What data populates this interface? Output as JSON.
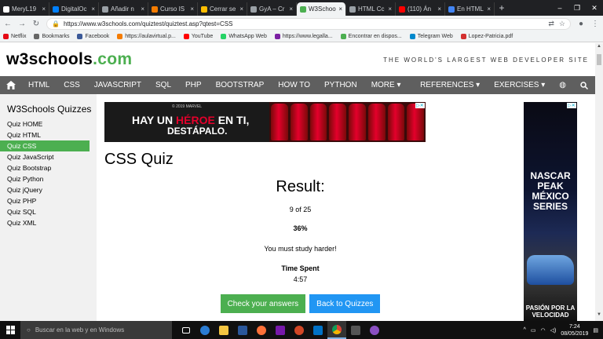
{
  "browser": {
    "tabs": [
      {
        "label": "MeryL19",
        "color": "#ffffff",
        "active": false
      },
      {
        "label": "DigitalOc",
        "color": "#0080ff",
        "active": false
      },
      {
        "label": "Añadir n",
        "color": "#9aa0a6",
        "active": false
      },
      {
        "label": "Curso IS",
        "color": "#f57c00",
        "active": false
      },
      {
        "label": "Cerrar se",
        "color": "#ffbe00",
        "active": false
      },
      {
        "label": "GyA – Cr",
        "color": "#9aa0a6",
        "active": false
      },
      {
        "label": "W3Schoo",
        "color": "#4CAF50",
        "active": true
      },
      {
        "label": "HTML Cc",
        "color": "#9aa0a6",
        "active": false
      },
      {
        "label": "(110) Án",
        "color": "#ff0000",
        "active": false
      },
      {
        "label": "En HTML",
        "color": "#4285f4",
        "active": false
      }
    ],
    "url": "https://www.w3schools.com/quiztest/quiztest.asp?qtest=CSS",
    "bookmarks": [
      "Netflix",
      "Bookmarks",
      "Facebook",
      "https://aulavirtual.p...",
      "YouTube",
      "WhatsApp Web",
      "https://www.legalla...",
      "Encontrar en dispos...",
      "Telegram Web",
      "Lopez-Patricia.pdf"
    ]
  },
  "site": {
    "logo_main": "w3schools",
    "logo_tld": ".com",
    "tagline": "THE WORLD'S LARGEST WEB DEVELOPER SITE",
    "nav": [
      "HTML",
      "CSS",
      "JAVASCRIPT",
      "SQL",
      "PHP",
      "BOOTSTRAP",
      "HOW TO",
      "PYTHON",
      "MORE ▾"
    ],
    "nav_right": [
      "REFERENCES ▾",
      "EXERCISES ▾"
    ]
  },
  "sidebar": {
    "title": "W3Schools Quizzes",
    "items": [
      "Quiz HOME",
      "Quiz HTML",
      "Quiz CSS",
      "Quiz JavaScript",
      "Quiz Bootstrap",
      "Quiz Python",
      "Quiz jQuery",
      "Quiz PHP",
      "Quiz SQL",
      "Quiz XML"
    ],
    "active_index": 2
  },
  "ads": {
    "top_line1a": "HAY UN ",
    "top_line1b": "HÉROE",
    "top_line1c": " EN TI,",
    "top_line2": "DESTÁPALO.",
    "top_small": "© 2019 MARVEL",
    "right_title": "NASCAR PEAK MÉXICO SERIES",
    "right_bottom": "PASIÓN POR LA VELOCIDAD"
  },
  "main": {
    "title": "CSS Quiz",
    "result_heading": "Result:",
    "score": "9 of 25",
    "percent": "36%",
    "message": "You must study harder!",
    "time_label": "Time Spent",
    "time_value": "4:57",
    "btn_check": "Check your answers",
    "btn_back": "Back to Quizzes"
  },
  "taskbar": {
    "search_placeholder": "Buscar en la web y en Windows",
    "time": "7:24",
    "date": "08/05/2019"
  }
}
